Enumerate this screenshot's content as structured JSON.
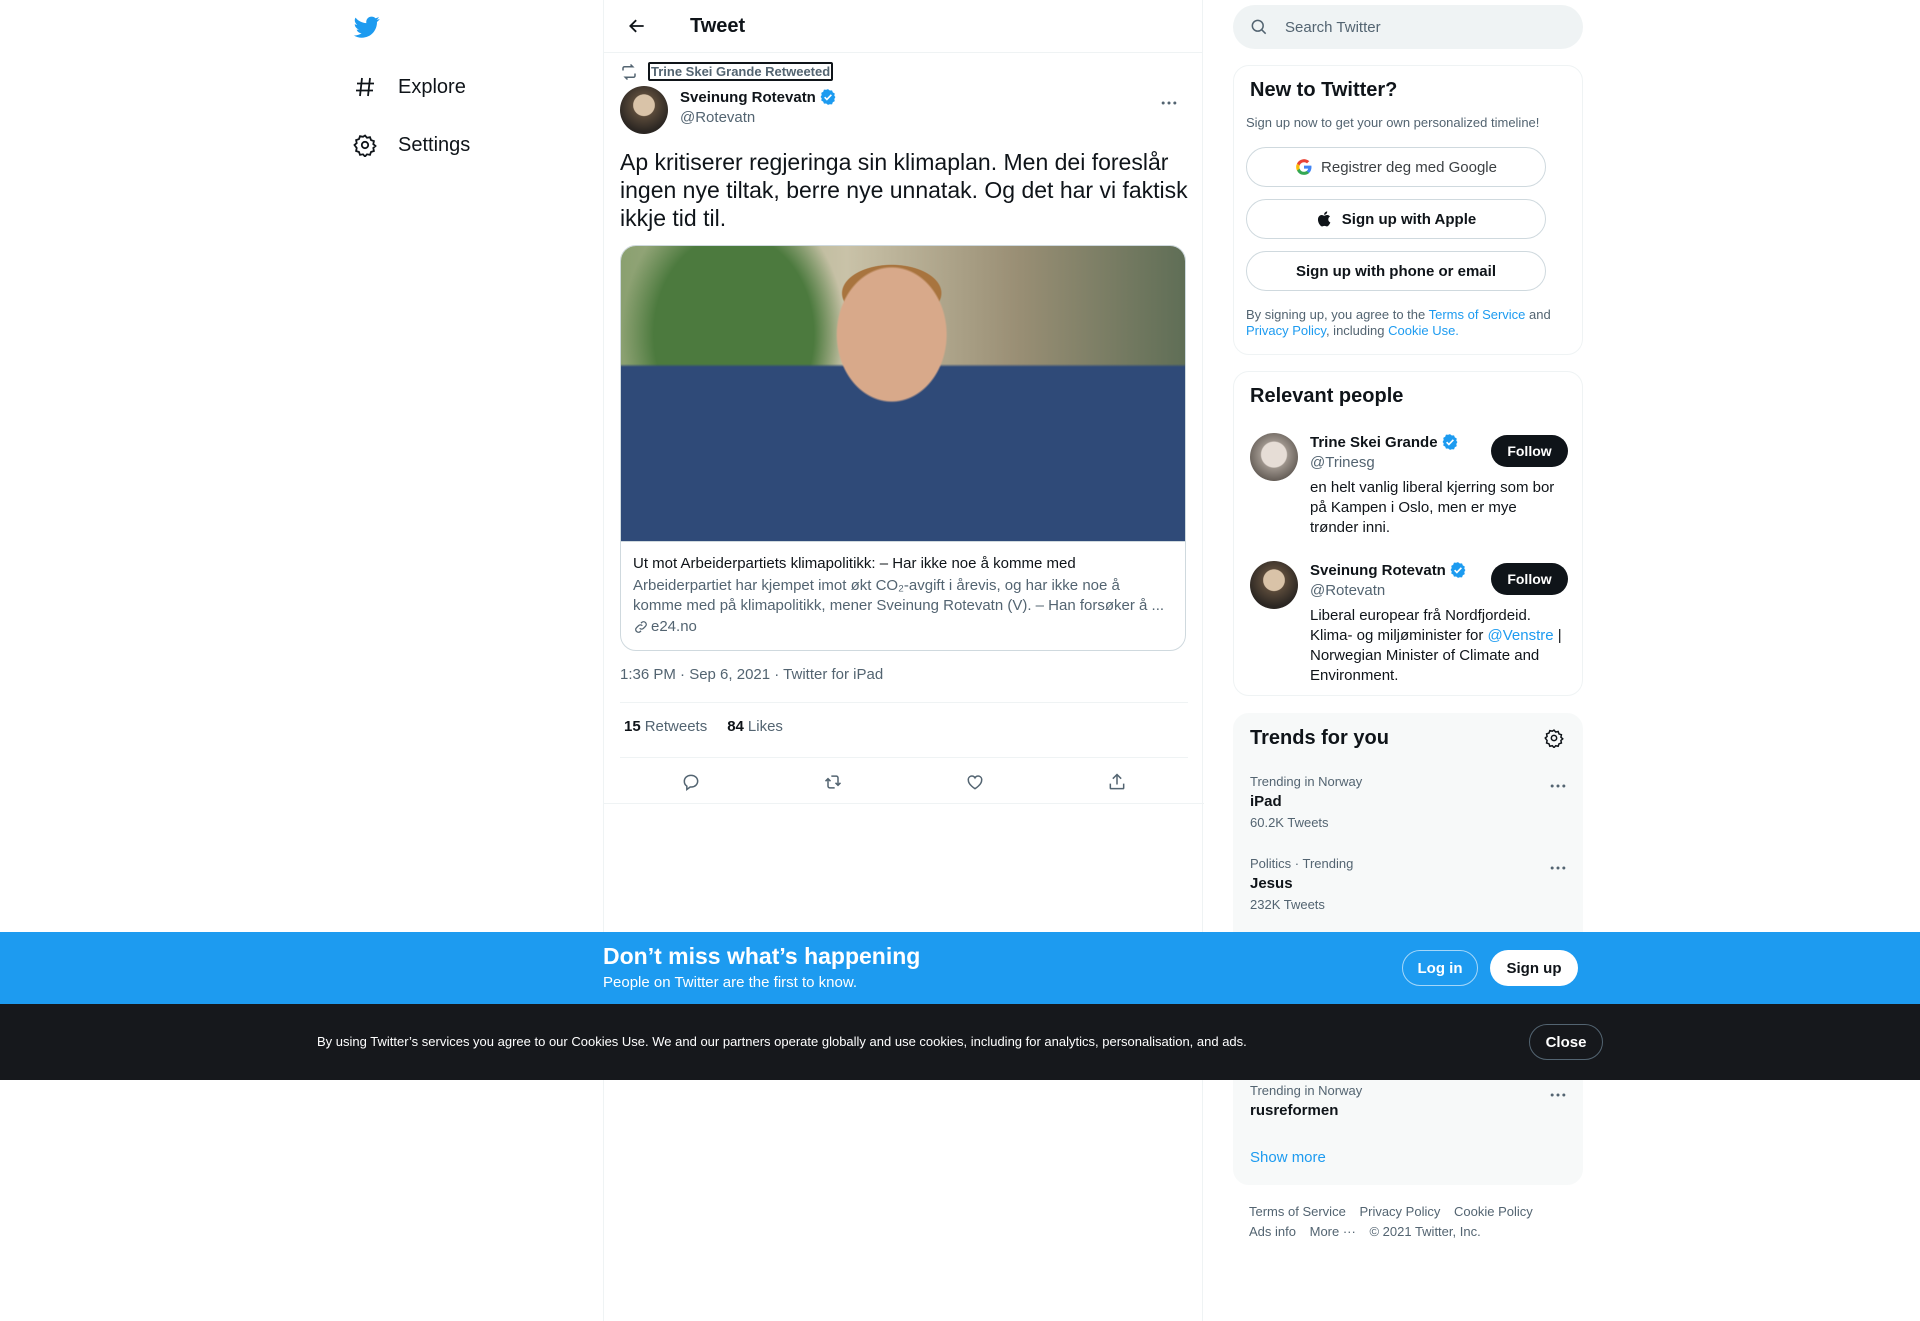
{
  "nav": {
    "items": [
      {
        "label": "Explore",
        "icon": "hashtag-icon"
      },
      {
        "label": "Settings",
        "icon": "gear-icon"
      }
    ]
  },
  "header": {
    "title": "Tweet"
  },
  "tweet": {
    "retweeted_by": "Trine Skei Grande Retweeted",
    "author_name": "Sveinung Rotevatn",
    "author_handle": "@Rotevatn",
    "text": "Ap kritiserer regjeringa sin klimaplan. Men dei foreslår ingen nye tiltak, berre nye unnatak. Og det har vi faktisk ikkje tid til.",
    "card": {
      "title": "Ut mot Arbeiderpartiets klimapolitikk: – Har ikke noe å komme med",
      "description": "Arbeiderpartiet har kjempet imot økt CO₂-avgift i årevis, og har ikke noe å komme med på klimapolitikk, mener Sveinung Rotevatn (V). – Han forsøker å ...",
      "domain": "e24.no"
    },
    "meta": "1:36 PM · Sep 6, 2021 · Twitter for iPad",
    "retweets_count": "15",
    "retweets_label": "Retweets",
    "likes_count": "84",
    "likes_label": "Likes"
  },
  "search": {
    "placeholder": "Search Twitter"
  },
  "new_to_twitter": {
    "title": "New to Twitter?",
    "subtitle": "Sign up now to get your own personalized timeline!",
    "google_label": "Registrer deg med Google",
    "apple_label": "Sign up with Apple",
    "phone_label": "Sign up with phone or email",
    "legal_1": "By signing up, you agree to the ",
    "legal_tos": "Terms of Service",
    "legal_2": " and ",
    "legal_privacy": "Privacy Policy",
    "legal_3": ", including ",
    "legal_cookie": "Cookie Use."
  },
  "relevant_people": {
    "title": "Relevant people",
    "people": [
      {
        "name": "Trine Skei Grande",
        "handle": "@Trinesg",
        "bio": "en helt vanlig liberal kjerring som bor på Kampen i Oslo, men er mye trønder inni.",
        "follow_label": "Follow"
      },
      {
        "name": "Sveinung Rotevatn",
        "handle": "@Rotevatn",
        "bio_1": "Liberal europear frå Nordfjordeid. Klima- og miljøminister for ",
        "bio_link": "@Venstre",
        "bio_2": " | Norwegian Minister of Climate and Environment.",
        "follow_label": "Follow"
      }
    ]
  },
  "trends": {
    "title": "Trends for you",
    "items": [
      {
        "category": "Trending in Norway",
        "name": "iPad",
        "count": "60.2K Tweets"
      },
      {
        "category": "Politics · Trending",
        "name": "Jesus",
        "count": "232K Tweets"
      },
      {
        "category": "Trending in Norway",
        "name": "rusreformen",
        "count": ""
      }
    ],
    "show_more": "Show more"
  },
  "footer": {
    "links": [
      "Terms of Service",
      "Privacy Policy",
      "Cookie Policy",
      "Ads info",
      "More ···"
    ],
    "copyright": "© 2021 Twitter, Inc."
  },
  "cta": {
    "title": "Don’t miss what’s happening",
    "subtitle": "People on Twitter are the first to know.",
    "login_label": "Log in",
    "signup_label": "Sign up"
  },
  "cookie": {
    "text": "By using Twitter’s services you agree to our Cookies Use. We and our partners operate globally and use cookies, including for analytics, personalisation, and ads.",
    "close_label": "Close"
  },
  "colors": {
    "brand": "#1d9bf0",
    "dark": "#0f1419",
    "muted": "#536471"
  }
}
